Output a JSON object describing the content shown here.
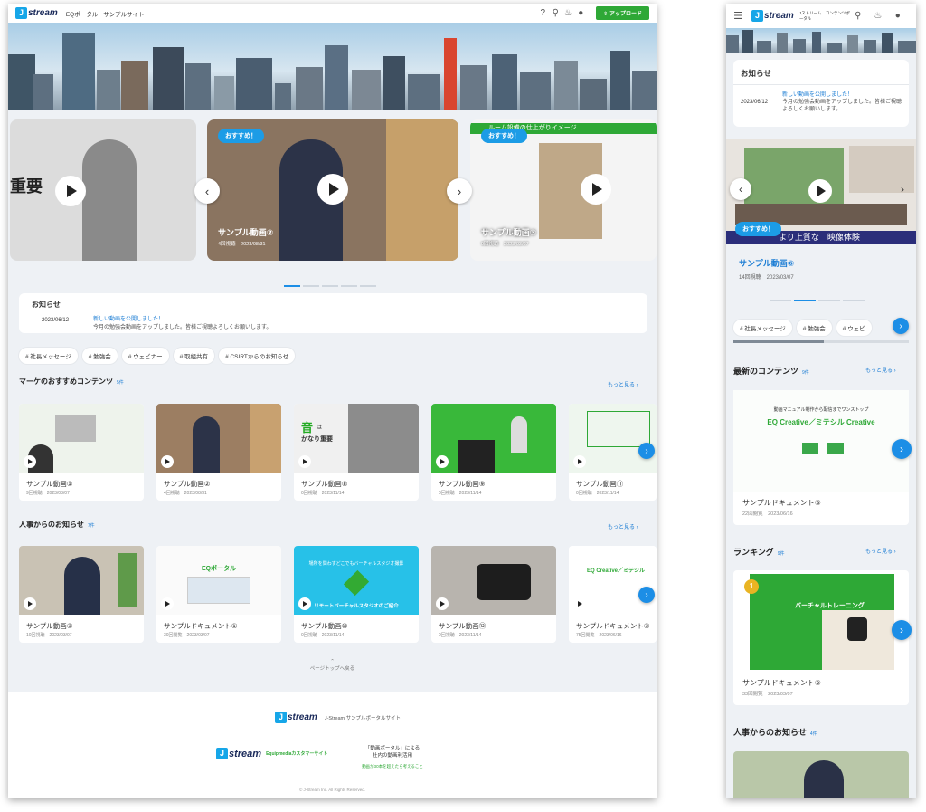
{
  "desktop": {
    "header": {
      "logo": "stream",
      "logo_j": "J",
      "nav": [
        "EQポータル",
        "サンプルサイト"
      ],
      "upload": "アップロード"
    },
    "hero": {
      "slides": [
        {
          "title": "",
          "meta": "",
          "badge": "",
          "banner": "",
          "overlay": "重要"
        },
        {
          "title": "サンプル動画②",
          "meta": "4回視聴　2023/08/31",
          "badge": "おすすめ！",
          "banner": ""
        },
        {
          "title": "サンプル動画③",
          "meta": "9回視聴　2023/03/07",
          "badge": "おすすめ！",
          "banner": "ルーム設備の仕上がりイメージ"
        }
      ]
    },
    "notice": {
      "title": "お知らせ",
      "date": "2023/06/12",
      "link": "新しい動画を公開しました！",
      "body": "今月の勉強会動画をアップしました。皆様ご視聴よろしくお願いします。"
    },
    "tags": [
      "# 社長メッセージ",
      "# 勉強会",
      "# ウェビナー",
      "# 取組共有",
      "# CSIRTからのお知らせ"
    ],
    "section1": {
      "title": "マーケのおすすめコンテンツ",
      "count": "5件",
      "more": "もっと見る",
      "items": [
        {
          "title": "サンプル動画①",
          "meta": "9回視聴　2023/03/07"
        },
        {
          "title": "サンプル動画②",
          "meta": "4回視聴　2023/08/31"
        },
        {
          "title": "サンプル動画⑧",
          "meta": "0回視聴　2023/11/14",
          "img_text1": "音",
          "img_text2": "は",
          "img_text3": "かなり重要"
        },
        {
          "title": "サンプル動画⑨",
          "meta": "0回視聴　2023/11/14"
        },
        {
          "title": "サンプル動画⑪",
          "meta": "0回視聴　2023/11/14"
        }
      ]
    },
    "section2": {
      "title": "人事からのお知らせ",
      "count": "7件",
      "more": "もっと見る",
      "items": [
        {
          "title": "サンプル動画③",
          "meta": "10回視聴　2023/03/07"
        },
        {
          "title": "サンプルドキュメント①",
          "meta": "30回閲覧　2023/03/07",
          "img_text1": "EQポータル"
        },
        {
          "title": "サンプル動画⑩",
          "meta": "0回視聴　2023/11/14",
          "img_text1": "場所を問わずどこでもバーチャルスタジオ撮影",
          "img_text2": "リモートバーチャルスタジオのご紹介"
        },
        {
          "title": "サンプル動画⑫",
          "meta": "0回視聴　2023/11/14"
        },
        {
          "title": "サンプルドキュメント③",
          "meta": "75回閲覧　2023/06/16",
          "img_text1": "EQ Creative／ミテシル"
        }
      ]
    },
    "page_top": "ページトップへ戻る",
    "footer": {
      "site": "J-Stream サンプルポータルサイト",
      "sub_logo": "Equipmediaカスタマーサイト",
      "promo1": "「動画ポータル」による",
      "promo2": "社内の動画利活用",
      "promo3": "動画が30本を超えたら考えること",
      "copyright": "© J-Stream Inc. All Rights Reserved."
    }
  },
  "mobile": {
    "header": {
      "logo": "stream",
      "logo_j": "J",
      "nav": "Jストリーム　コンテンツポータル"
    },
    "notice": {
      "title": "お知らせ",
      "date": "2023/06/12",
      "link": "新しい動画を公開しました！",
      "body": "今月の勉強会動画をアップしました。皆様ご視聴よろしくお願いします。"
    },
    "hero": {
      "title": "サンプル動画⑥",
      "meta": "14回視聴　2023/03/07",
      "badge": "おすすめ！",
      "banner": "より上質な　映像体験"
    },
    "tags": [
      "# 社長メッセージ",
      "# 勉強会",
      "# ウェビ"
    ],
    "latest": {
      "title": "最新のコンテンツ",
      "count": "9件",
      "more": "もっと見る",
      "item_title": "サンプルドキュメント③",
      "item_meta": "22回閲覧　2023/06/16",
      "img_text1": "動画マニュアル制作から配信までワンストップ",
      "img_text2": "EQ Creative／ミテシル Creative"
    },
    "ranking": {
      "title": "ランキング",
      "count": "9件",
      "more": "もっと見る",
      "rank": "1",
      "item_title": "サンプルドキュメント②",
      "item_meta": "33回閲覧　2023/03/07",
      "img_text1": "バーチャルトレーニング"
    },
    "hr": {
      "title": "人事からのお知らせ",
      "count": "4件"
    }
  },
  "colors": {
    "accent": "#1c8ee6",
    "upload": "#2ea836",
    "bg": "#eef1f5"
  }
}
